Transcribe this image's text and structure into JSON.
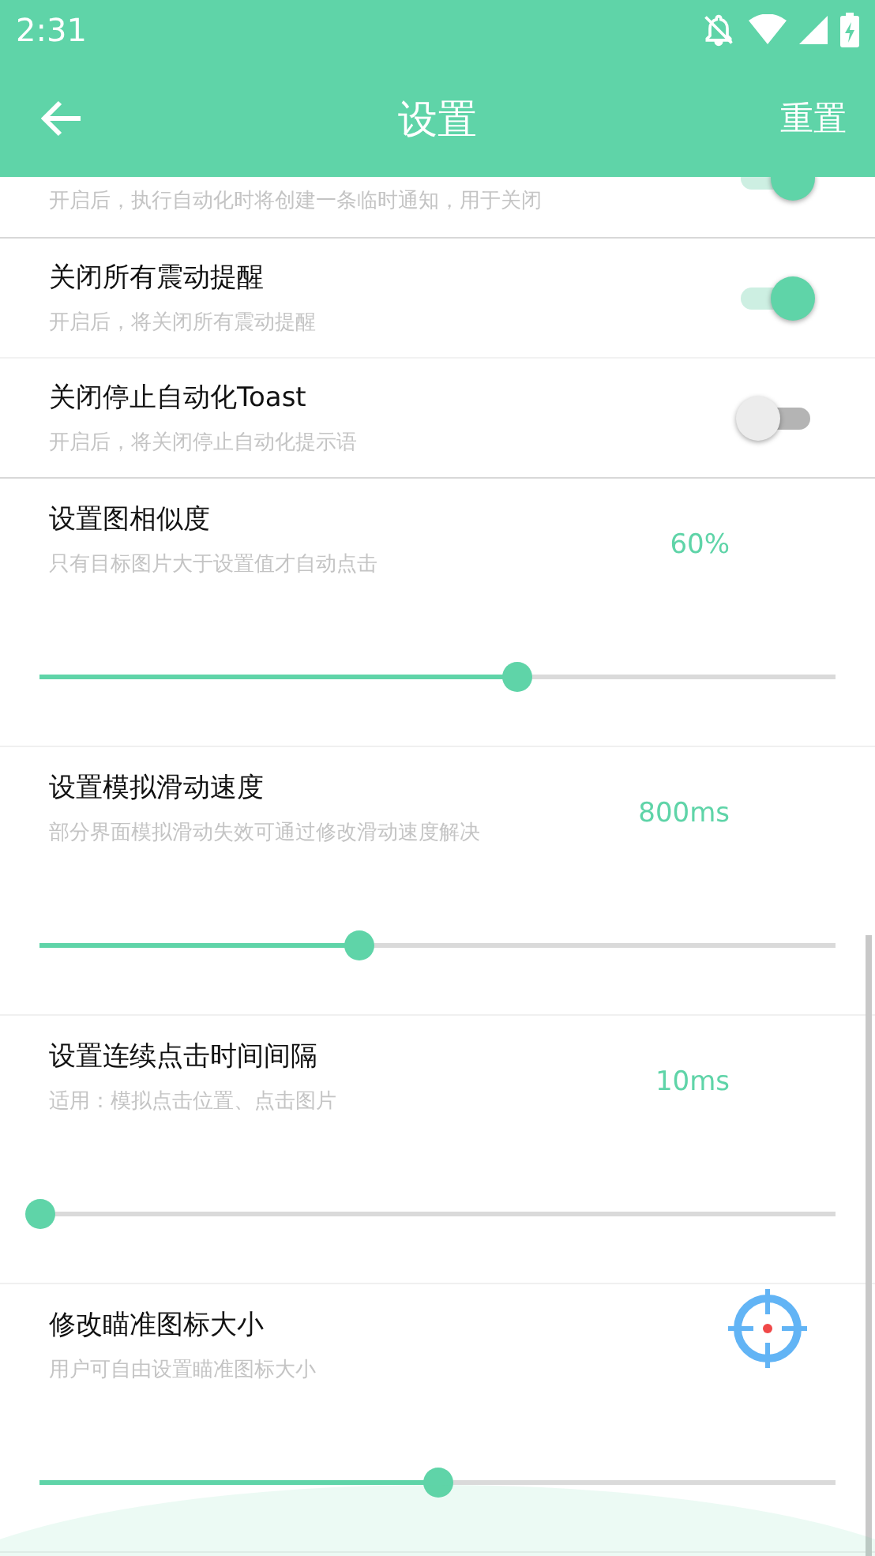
{
  "status_bar": {
    "time": "2:31"
  },
  "toolbar": {
    "title": "设置",
    "action": "重置"
  },
  "toggles": [
    {
      "subtitle": "开启后，执行自动化时将创建一条临时通知，用于关闭",
      "on": true
    },
    {
      "title": "关闭所有震动提醒",
      "subtitle": "开启后，将关闭所有震动提醒",
      "on": true
    },
    {
      "title": "关闭停止自动化Toast",
      "subtitle": "开启后，将关闭停止自动化提示语",
      "on": false
    }
  ],
  "sliders": [
    {
      "kind": "value",
      "title": "设置图相似度",
      "subtitle": "只有目标图片大于设置值才自动点击",
      "value": "60%",
      "level": 0.6
    },
    {
      "kind": "value",
      "title": "设置模拟滑动速度",
      "subtitle": "部分界面模拟滑动失效可通过修改滑动速度解决",
      "value": "800ms",
      "level": 0.4
    },
    {
      "kind": "value",
      "title": "设置连续点击时间间隔",
      "subtitle": "适用：模拟点击位置、点击图片",
      "value": "10ms",
      "level": 0
    },
    {
      "kind": "icon",
      "title": "修改瞄准图标大小",
      "subtitle": "用户可自由设置瞄准图标大小",
      "level": 0.5
    }
  ]
}
